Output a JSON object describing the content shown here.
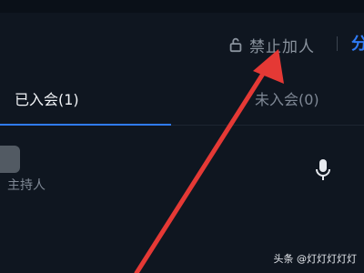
{
  "header": {
    "lock_label": "禁止加人",
    "share_label": "分"
  },
  "tabs": {
    "joined": "已入会(1)",
    "not_joined": "未入会(0)"
  },
  "participant": {
    "role": "主持人"
  },
  "watermark": "头条 @灯灯灯灯灯",
  "colors": {
    "accent": "#2f7bf5",
    "arrow": "#e53935",
    "background": "#0f1620"
  },
  "icons": [
    "lock-icon",
    "microphone-icon"
  ]
}
